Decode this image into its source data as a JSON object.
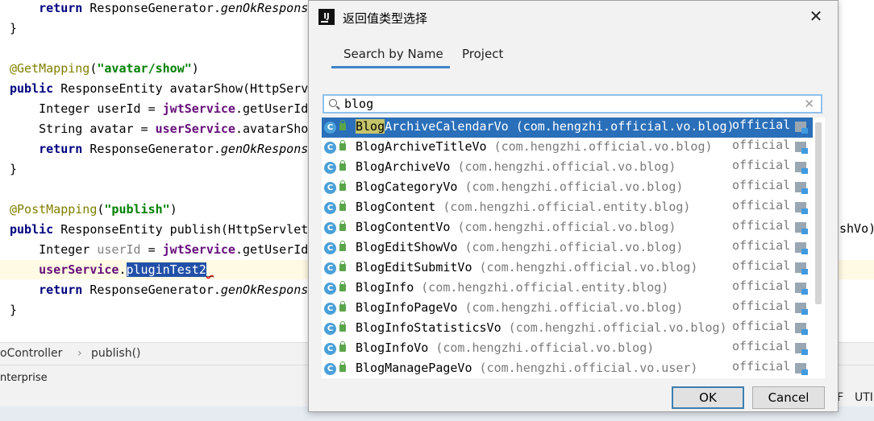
{
  "editor": {
    "lines": [
      {
        "indent": "    ",
        "parts": [
          {
            "t": "return",
            "c": "kw"
          },
          {
            "t": " ResponseGenerator."
          },
          {
            "t": "genOkResponse",
            "c": "ital"
          }
        ]
      },
      {
        "parts": [
          {
            "t": "}"
          }
        ]
      },
      {
        "parts": []
      },
      {
        "parts": [
          {
            "t": "@GetMapping",
            "c": "ann"
          },
          {
            "t": "("
          },
          {
            "t": "\"avatar/show\"",
            "c": "str"
          },
          {
            "t": ")"
          }
        ]
      },
      {
        "parts": [
          {
            "t": "public",
            "c": "kw"
          },
          {
            "t": " ResponseEntity avatarShow(HttpServ"
          }
        ]
      },
      {
        "indent": "    ",
        "parts": [
          {
            "t": "Integer userId = "
          },
          {
            "t": "jwtService",
            "c": "fld"
          },
          {
            "t": ".getUserId"
          }
        ]
      },
      {
        "indent": "    ",
        "parts": [
          {
            "t": "String avatar = "
          },
          {
            "t": "userService",
            "c": "fld"
          },
          {
            "t": ".avatarSho"
          }
        ]
      },
      {
        "indent": "    ",
        "parts": [
          {
            "t": "return",
            "c": "kw"
          },
          {
            "t": " ResponseGenerator."
          },
          {
            "t": "genOkRespons",
            "c": "ital"
          }
        ]
      },
      {
        "parts": [
          {
            "t": "}"
          }
        ]
      },
      {
        "parts": []
      },
      {
        "parts": [
          {
            "t": "@PostMapping",
            "c": "ann"
          },
          {
            "t": "("
          },
          {
            "t": "\"publish\"",
            "c": "str"
          },
          {
            "t": ")"
          }
        ]
      },
      {
        "parts": [
          {
            "t": "public",
            "c": "kw"
          },
          {
            "t": " ResponseEntity publish(HttpServlet"
          }
        ]
      },
      {
        "indent": "    ",
        "parts": [
          {
            "t": "Integer "
          },
          {
            "t": "userId",
            "c": "unused"
          },
          {
            "t": " = "
          },
          {
            "t": "jwtService",
            "c": "fld"
          },
          {
            "t": ".getUserId"
          }
        ]
      },
      {
        "indent": "    ",
        "highlight": true,
        "parts": [
          {
            "t": "userService",
            "c": "fld"
          },
          {
            "t": "."
          },
          {
            "t": "pluginTest2",
            "c": "sel"
          },
          {
            "t": "_",
            "c": "sel-u"
          }
        ]
      },
      {
        "indent": "    ",
        "parts": [
          {
            "t": "return",
            "c": "kw"
          },
          {
            "t": " ResponseGenerator."
          },
          {
            "t": "genOkRespons",
            "c": "ital"
          }
        ]
      },
      {
        "parts": [
          {
            "t": "}"
          }
        ]
      }
    ],
    "right_fragment": "shVo)"
  },
  "breadcrumb": {
    "left": "oController",
    "sep": "›",
    "right": "publish()"
  },
  "status": {
    "left": "nterprise",
    "right_1": "F",
    "right_2": "UTI"
  },
  "dialog": {
    "title": "返回值类型选择",
    "app_icon_letters": "IJ",
    "close_glyph": "✕",
    "tabs": [
      {
        "label": "Search by Name",
        "active": true
      },
      {
        "label": "Project",
        "active": false
      }
    ],
    "search": {
      "value": "blog",
      "clear_glyph": "✕"
    },
    "results": [
      {
        "match": "Blog",
        "rest": "ArchiveCalendarVo",
        "pkg": "(com.hengzhi.official.vo.blog)",
        "module": "official",
        "selected": true
      },
      {
        "match": "",
        "rest": "BlogArchiveTitleVo",
        "pkg": "(com.hengzhi.official.vo.blog)",
        "module": "official"
      },
      {
        "match": "",
        "rest": "BlogArchiveVo",
        "pkg": "(com.hengzhi.official.vo.blog)",
        "module": "official"
      },
      {
        "match": "",
        "rest": "BlogCategoryVo",
        "pkg": "(com.hengzhi.official.vo.blog)",
        "module": "official"
      },
      {
        "match": "",
        "rest": "BlogContent",
        "pkg": "(com.hengzhi.official.entity.blog)",
        "module": "official"
      },
      {
        "match": "",
        "rest": "BlogContentVo",
        "pkg": "(com.hengzhi.official.vo.blog)",
        "module": "official"
      },
      {
        "match": "",
        "rest": "BlogEditShowVo",
        "pkg": "(com.hengzhi.official.vo.blog)",
        "module": "official"
      },
      {
        "match": "",
        "rest": "BlogEditSubmitVo",
        "pkg": "(com.hengzhi.official.vo.blog)",
        "module": "official"
      },
      {
        "match": "",
        "rest": "BlogInfo",
        "pkg": "(com.hengzhi.official.entity.blog)",
        "module": "official"
      },
      {
        "match": "",
        "rest": "BlogInfoPageVo",
        "pkg": "(com.hengzhi.official.vo.blog)",
        "module": "official"
      },
      {
        "match": "",
        "rest": "BlogInfoStatisticsVo",
        "pkg": "(com.hengzhi.official.vo.blog)",
        "module": "official"
      },
      {
        "match": "",
        "rest": "BlogInfoVo",
        "pkg": "(com.hengzhi.official.vo.blog)",
        "module": "official"
      },
      {
        "match": "",
        "rest": "BlogManagePageVo",
        "pkg": "(com.hengzhi.official.vo.user)",
        "module": "official"
      }
    ],
    "class_icon_letter": "C",
    "ok_label": "OK",
    "cancel_label": "Cancel"
  },
  "colors": {
    "selection": "#2a6fb9",
    "tab_accent": "#4083c9",
    "match_highlight": "#c6c46a"
  }
}
